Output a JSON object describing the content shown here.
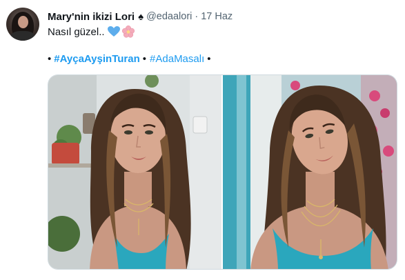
{
  "author": {
    "display_name": "Mary'nin ikizi Lori",
    "badge_icon": "spade-icon",
    "badge_glyph": "♠",
    "handle": "@edaalori",
    "separator": "·",
    "time": "17 Haz"
  },
  "tweet": {
    "text": "Nasıl güzel..",
    "emojis": [
      "blue-heart-icon",
      "cherry-blossom-icon"
    ],
    "tags_line": {
      "bullet": "•",
      "hashtag_primary": "#AyçaAyşinTuran",
      "hashtag_secondary": "#AdaMasalı"
    }
  },
  "media": {
    "count": 2,
    "items": [
      "photo-left",
      "photo-right"
    ]
  },
  "colors": {
    "text": "#0f1419",
    "secondary": "#536471",
    "link": "#1d9bf0",
    "border": "#cfd9de"
  }
}
